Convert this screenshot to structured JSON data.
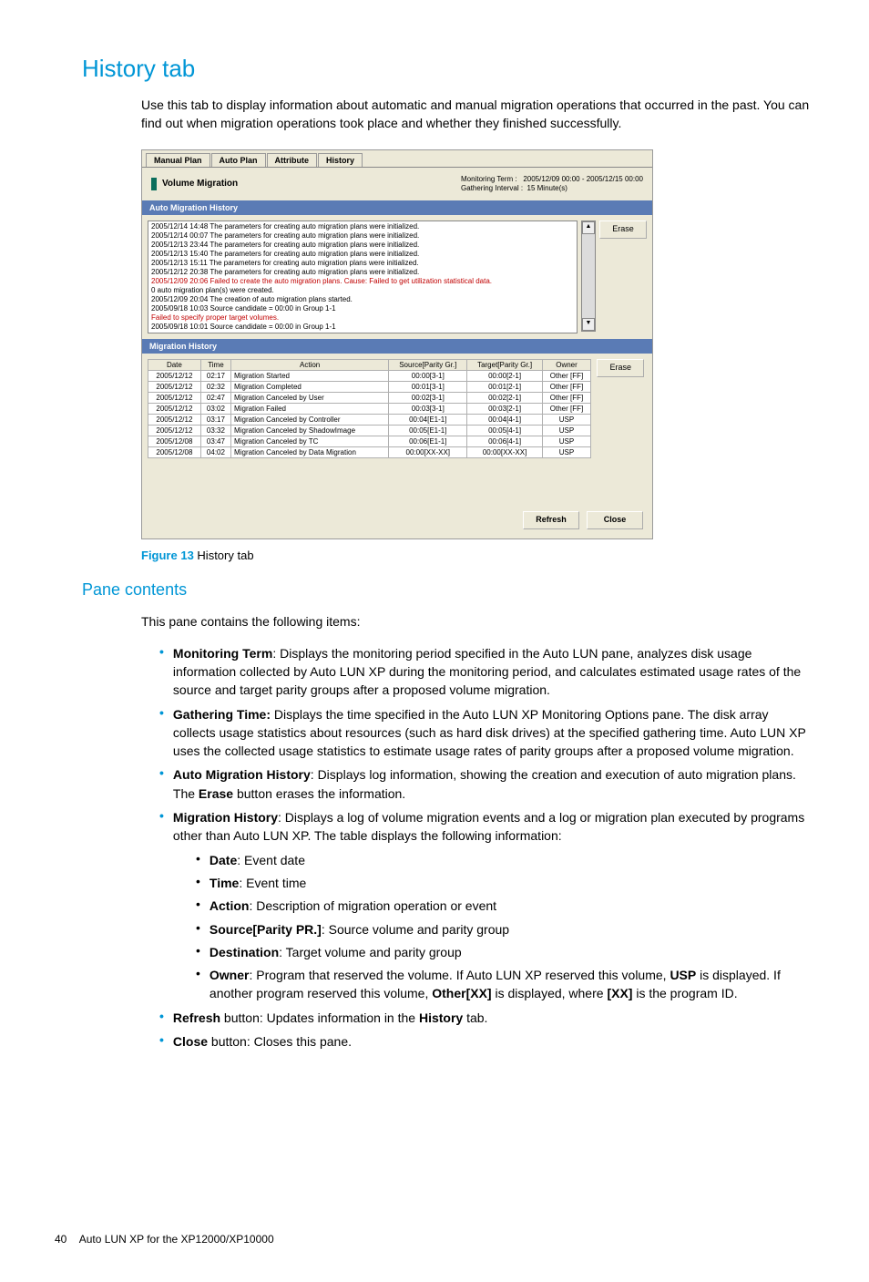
{
  "heading": "History tab",
  "intro": "Use this tab to display information about automatic and manual migration operations that occurred in the past. You can find out when migration operations took place and whether they finished successfully.",
  "screenshot": {
    "tabs": [
      "Manual Plan",
      "Auto Plan",
      "Attribute",
      "History"
    ],
    "vm_title": "Volume Migration",
    "monitoring_term_label": "Monitoring Term :",
    "monitoring_term_value": "2005/12/09 00:00  -  2005/12/15 00:00",
    "gathering_label": "Gathering Interval :",
    "gathering_value": "15  Minute(s)",
    "auto_history_title": "Auto Migration History",
    "log_lines": [
      "2005/12/14 14:48 The parameters for creating auto migration plans were initialized.",
      "2005/12/14 00:07 The parameters for creating auto migration plans were initialized.",
      "2005/12/13 23:44 The parameters for creating auto migration plans were initialized.",
      "2005/12/13 15:40 The parameters for creating auto migration plans were initialized.",
      "2005/12/13 15:11 The parameters for creating auto migration plans were initialized.",
      "2005/12/12 20:38 The parameters for creating auto migration plans were initialized.",
      "2005/12/09 20:06 Failed to create the auto migration plans. Cause: Failed to get utilization statistical data.",
      "  0 auto migration plan(s) were created.",
      "2005/12/09 20:04 The creation of auto migration plans started.",
      "2005/09/18 10:03 Source candidate = 00:00 in Group 1-1",
      "  Failed to specify proper target volumes.",
      "2005/09/18 10:01 Source candidate = 00:00 in Group 1-1"
    ],
    "erase_label": "Erase",
    "migration_history_title": "Migration History",
    "mh_headers": [
      "Date",
      "Time",
      "Action",
      "Source[Parity Gr.]",
      "Target[Parity Gr.]",
      "Owner"
    ],
    "mh_rows": [
      [
        "2005/12/12",
        "02:17",
        "Migration Started",
        "00:00[3-1]",
        "00:00[2-1]",
        "Other [FF]"
      ],
      [
        "2005/12/12",
        "02:32",
        "Migration Completed",
        "00:01[3-1]",
        "00:01[2-1]",
        "Other [FF]"
      ],
      [
        "2005/12/12",
        "02:47",
        "Migration Canceled by User",
        "00:02[3-1]",
        "00:02[2-1]",
        "Other [FF]"
      ],
      [
        "2005/12/12",
        "03:02",
        "Migration Failed",
        "00:03[3-1]",
        "00:03[2-1]",
        "Other [FF]"
      ],
      [
        "2005/12/12",
        "03:17",
        "Migration Canceled by Controller",
        "00:04[E1-1]",
        "00:04[4-1]",
        "USP"
      ],
      [
        "2005/12/12",
        "03:32",
        "Migration Canceled by ShadowImage",
        "00:05[E1-1]",
        "00:05[4-1]",
        "USP"
      ],
      [
        "2005/12/08",
        "03:47",
        "Migration Canceled by TC",
        "00:06[E1-1]",
        "00:06[4-1]",
        "USP"
      ],
      [
        "2005/12/08",
        "04:02",
        "Migration Canceled by Data Migration",
        "00:00[XX-XX]",
        "00:00[XX-XX]",
        "USP"
      ]
    ],
    "refresh_label": "Refresh",
    "close_label": "Close"
  },
  "figure": {
    "num": "Figure 13",
    "caption": "History tab"
  },
  "pane_contents_heading": "Pane contents",
  "pane_intro": "This pane contains the following items:",
  "items": {
    "monitoring": {
      "label": "Monitoring Term",
      "text": ": Displays the monitoring period specified in the Auto LUN pane, analyzes disk usage information collected by Auto LUN XP during the monitoring period, and calculates estimated usage rates of the source and target parity groups after a proposed volume migration."
    },
    "gathering": {
      "label": "Gathering Time:",
      "text": " Displays the time specified in the Auto LUN XP Monitoring Options pane. The disk array collects usage statistics about resources (such as hard disk drives) at the specified gathering time. Auto LUN XP uses the collected usage statistics to estimate usage rates of parity groups after a proposed volume migration."
    },
    "auto": {
      "label": "Auto Migration History",
      "text1": ": Displays log information, showing the creation and execution of auto migration plans. The ",
      "erase": "Erase",
      "text2": " button erases the information."
    },
    "mh": {
      "label": "Migration History",
      "text": ": Displays a log of volume migration events and a log or migration plan executed by programs other than Auto LUN XP. The table displays the following information:"
    },
    "refresh": {
      "label": "Refresh",
      "text1": " button: Updates information in the ",
      "hist": "History",
      "text2": " tab."
    },
    "close": {
      "label": "Close",
      "text": " button: Closes this pane."
    }
  },
  "sub": {
    "date": {
      "label": "Date",
      "text": ": Event date"
    },
    "time": {
      "label": "Time",
      "text": ": Event time"
    },
    "action": {
      "label": "Action",
      "text": ": Description of migration operation or event"
    },
    "source": {
      "label": "Source[Parity PR.]",
      "text": ": Source volume and parity group"
    },
    "dest": {
      "label": "Destination",
      "text": ": Target volume and parity group"
    },
    "owner": {
      "label": "Owner",
      "t1": ": Program that reserved the volume. If Auto LUN XP reserved this volume, ",
      "b1": "USP",
      "t2": " is displayed. If another program reserved this volume, ",
      "b2": "Other[XX]",
      "t3": " is displayed, where ",
      "b3": "[XX]",
      "t4": " is the program ID."
    }
  },
  "footer": {
    "page": "40",
    "title": "Auto LUN XP for the XP12000/XP10000"
  }
}
